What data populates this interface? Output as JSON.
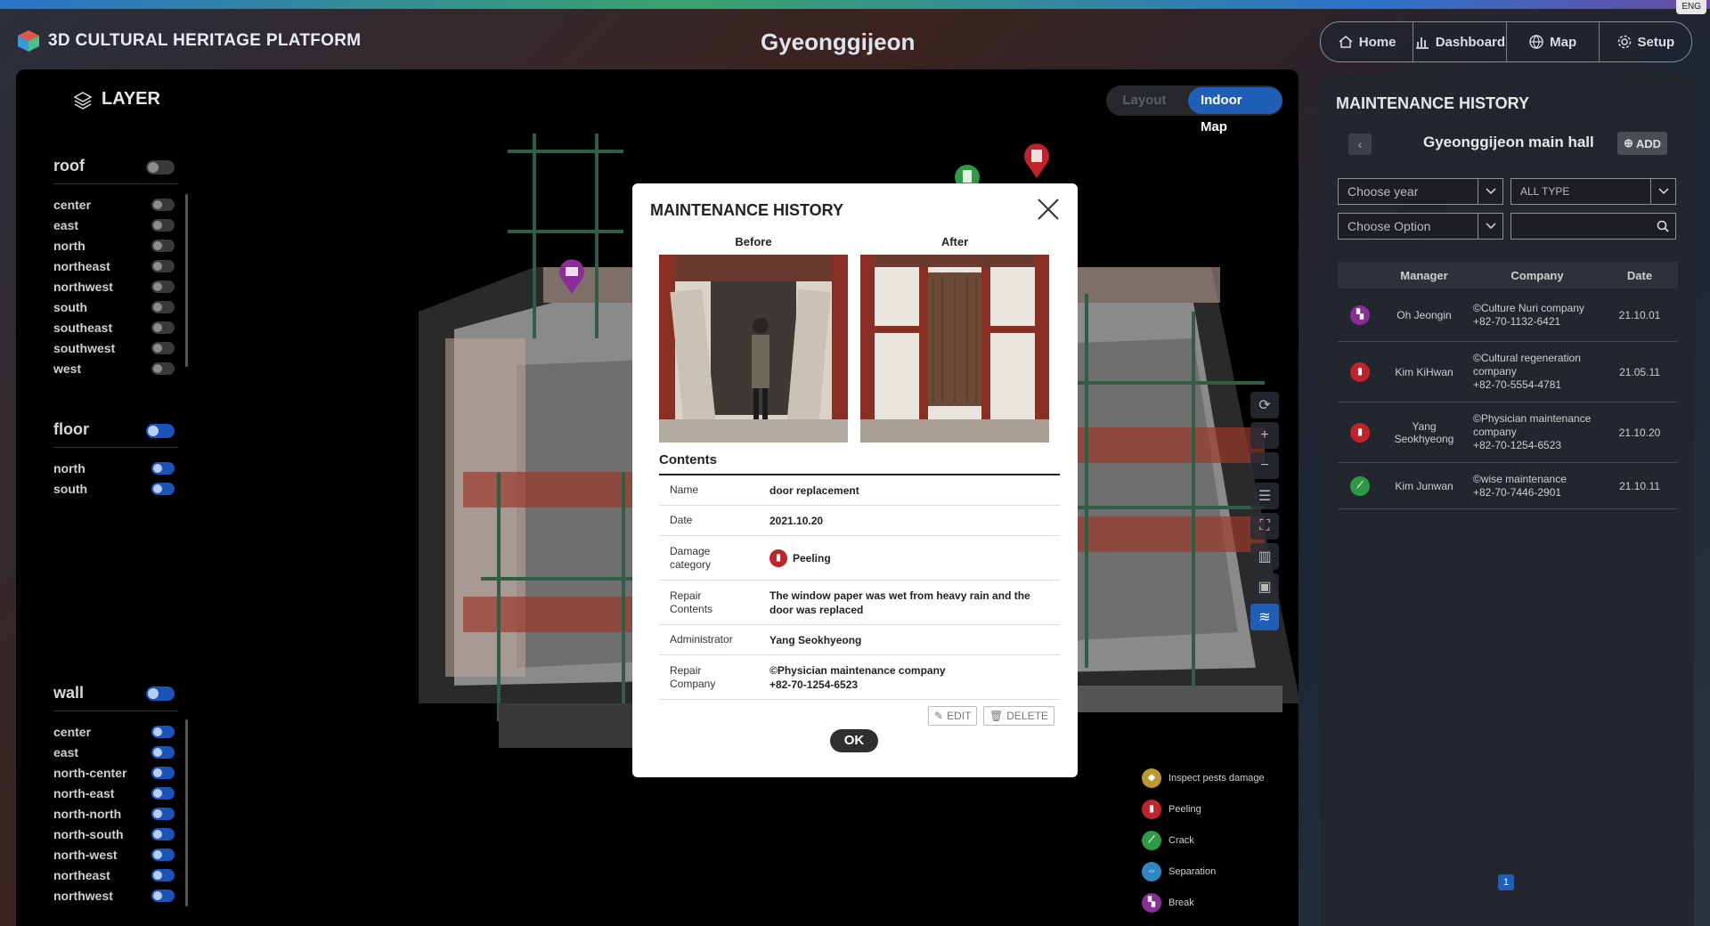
{
  "lang": "ENG",
  "app_title": "3D CULTURAL HERITAGE PLATFORM",
  "page_title": "Gyeonggijeon",
  "nav": [
    "Home",
    "Dashboard",
    "Map",
    "Setup"
  ],
  "layer_panel": {
    "title": "LAYER",
    "groups": [
      {
        "name": "roof",
        "items": [
          "center",
          "east",
          "north",
          "northeast",
          "northwest",
          "south",
          "southeast",
          "southwest",
          "west"
        ]
      },
      {
        "name": "floor",
        "items": [
          "north",
          "south"
        ]
      },
      {
        "name": "wall",
        "items": [
          "center",
          "east",
          "north-center",
          "north-east",
          "north-north",
          "north-south",
          "north-west",
          "northeast",
          "northwest"
        ]
      }
    ]
  },
  "view_toggle": {
    "inactive": "Layout",
    "active": "Indoor Map"
  },
  "legend": [
    {
      "label": "Inspect pests damage",
      "color": "#b99a2e",
      "glyph": "◆"
    },
    {
      "label": "Peeling",
      "color": "#c0242a",
      "glyph": "▮"
    },
    {
      "label": "Crack",
      "color": "#2f9a46",
      "glyph": "⟋"
    },
    {
      "label": "Separation",
      "color": "#2f86c0",
      "glyph": "⇔"
    },
    {
      "label": "Break",
      "color": "#8a2d97",
      "glyph": "▚"
    }
  ],
  "right_panel": {
    "title": "MAINTENANCE HISTORY",
    "subtitle": "Gyeonggijeon main hall",
    "add_label": "ADD",
    "year_placeholder": "Choose year",
    "type_placeholder": "ALL TYPE",
    "option_placeholder": "Choose Option",
    "table": {
      "headers": [
        "Manager",
        "Company",
        "Date"
      ],
      "rows": [
        {
          "icon_color": "#8a2d97",
          "icon": "break-icon",
          "manager": "Oh Jeongin",
          "company": "©Culture Nuri company",
          "phone": "+82-70-1132-6421",
          "date": "21.10.01"
        },
        {
          "icon_color": "#c0242a",
          "icon": "peeling-icon",
          "manager": "Kim KiHwan",
          "company": "©Cultural regeneration company",
          "phone": "+82-70-5554-4781",
          "date": "21.05.11"
        },
        {
          "icon_color": "#c0242a",
          "icon": "peeling-icon",
          "manager": "Yang Seokhyeong",
          "company": "©Physician maintenance company",
          "phone": "+82-70-1254-6523",
          "date": "21.10.20"
        },
        {
          "icon_color": "#2f9a46",
          "icon": "crack-icon",
          "manager": "Kim Junwan",
          "company": "©wise maintenance",
          "phone": "+82-70-7446-2901",
          "date": "21.10.11"
        }
      ]
    },
    "page": "1"
  },
  "modal": {
    "title": "MAINTENANCE HISTORY",
    "before_label": "Before",
    "after_label": "After",
    "contents_label": "Contents",
    "fields": [
      {
        "key": "Name",
        "value": "door replacement"
      },
      {
        "key": "Date",
        "value": "2021.10.20"
      },
      {
        "key": "Damage category",
        "value": "Peeling"
      },
      {
        "key": "Repair Contents",
        "value": "The window paper was wet from heavy rain and the door was replaced"
      },
      {
        "key": "Administrator",
        "value": "Yang Seokhyeong"
      },
      {
        "key": "Repair Company",
        "value": "©Physician maintenance company\n+82-70-1254-6523"
      }
    ],
    "edit_label": "EDIT",
    "delete_label": "DELETE",
    "ok_label": "OK"
  }
}
